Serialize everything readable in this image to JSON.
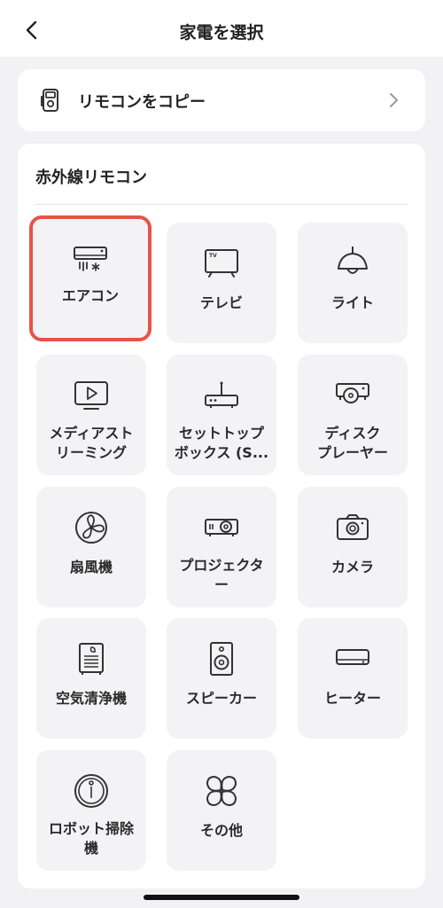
{
  "header": {
    "title": "家電を選択",
    "back_icon": "chevron-left-icon"
  },
  "copy_remote": {
    "label": "リモコンをコピー",
    "icon": "remote-icon",
    "chevron": "chevron-right-icon"
  },
  "section": {
    "title": "赤外線リモコン"
  },
  "devices": [
    {
      "label": "エアコン",
      "icon": "air-conditioner-icon",
      "selected": true
    },
    {
      "label": "テレビ",
      "icon": "tv-icon"
    },
    {
      "label": "ライト",
      "icon": "light-icon"
    },
    {
      "label": "メディアスト\nリーミング",
      "icon": "media-streaming-icon"
    },
    {
      "label": "セットトップ\nボックス (S...",
      "icon": "set-top-box-icon"
    },
    {
      "label": "ディスク\nプレーヤー",
      "icon": "disc-player-icon"
    },
    {
      "label": "扇風機",
      "icon": "fan-icon"
    },
    {
      "label": "プロジェクタ\nー",
      "icon": "projector-icon"
    },
    {
      "label": "カメラ",
      "icon": "camera-icon"
    },
    {
      "label": "空気清浄機",
      "icon": "air-purifier-icon"
    },
    {
      "label": "スピーカー",
      "icon": "speaker-icon"
    },
    {
      "label": "ヒーター",
      "icon": "heater-icon"
    },
    {
      "label": "ロボット掃除\n機",
      "icon": "robot-vacuum-icon"
    },
    {
      "label": "その他",
      "icon": "other-icon"
    }
  ],
  "colors": {
    "selected_border": "#e8524a",
    "tile_bg": "#f3f3f5",
    "page_bg": "#f2f2f4"
  }
}
